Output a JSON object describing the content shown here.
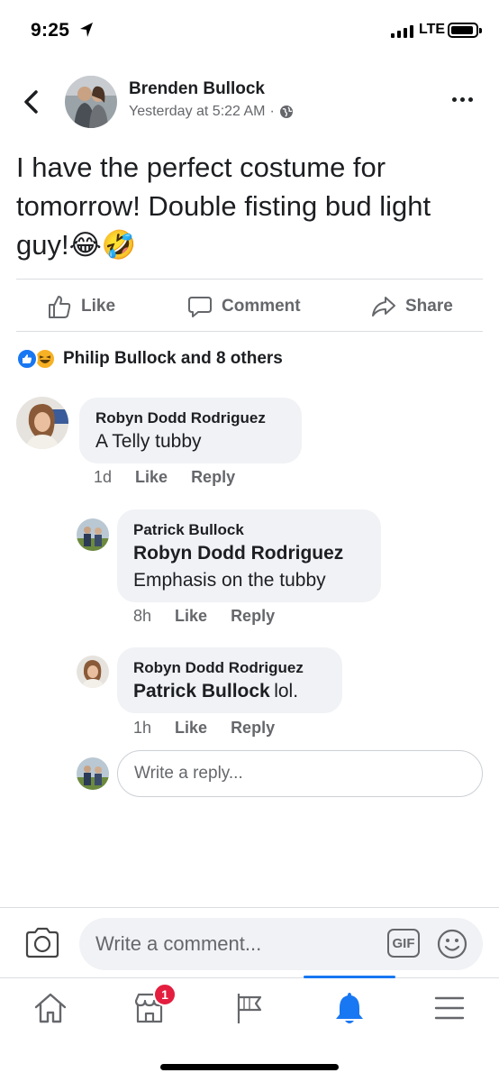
{
  "status_bar": {
    "time": "9:25",
    "network": "LTE"
  },
  "post": {
    "author": "Brenden Bullock",
    "timestamp": "Yesterday at 5:22 AM",
    "separator": "·",
    "privacy_icon": "globe-icon",
    "text": "I have the perfect costume for tomorrow!  Double fisting bud light guy!😂🤣"
  },
  "actions": {
    "like": "Like",
    "comment": "Comment",
    "share": "Share"
  },
  "reactions": {
    "summary": "Philip Bullock and 8 others",
    "types": [
      "like",
      "haha"
    ]
  },
  "comments": [
    {
      "author": "Robyn Dodd Rodriguez",
      "text": "A Telly tubby",
      "time": "1d",
      "like": "Like",
      "reply": "Reply",
      "replies": [
        {
          "author": "Patrick Bullock",
          "tag": "Robyn Dodd Rodriguez",
          "text": "Emphasis on the tubby",
          "time": "8h",
          "like": "Like",
          "reply": "Reply"
        },
        {
          "author": "Robyn Dodd Rodriguez",
          "tag": "Patrick Bullock",
          "text": "lol.",
          "time": "1h",
          "like": "Like",
          "reply": "Reply"
        }
      ]
    }
  ],
  "reply_input": {
    "placeholder": "Write a reply..."
  },
  "comment_input": {
    "placeholder": "Write a comment...",
    "gif": "GIF"
  },
  "nav": {
    "items": [
      "home",
      "marketplace",
      "pages",
      "notifications",
      "menu"
    ],
    "active": "notifications",
    "marketplace_badge": "1"
  },
  "colors": {
    "accent": "#1877f2",
    "text": "#1c1e21",
    "secondary": "#65676b",
    "bubble": "#f0f2f5",
    "badge": "#e41e3f"
  }
}
